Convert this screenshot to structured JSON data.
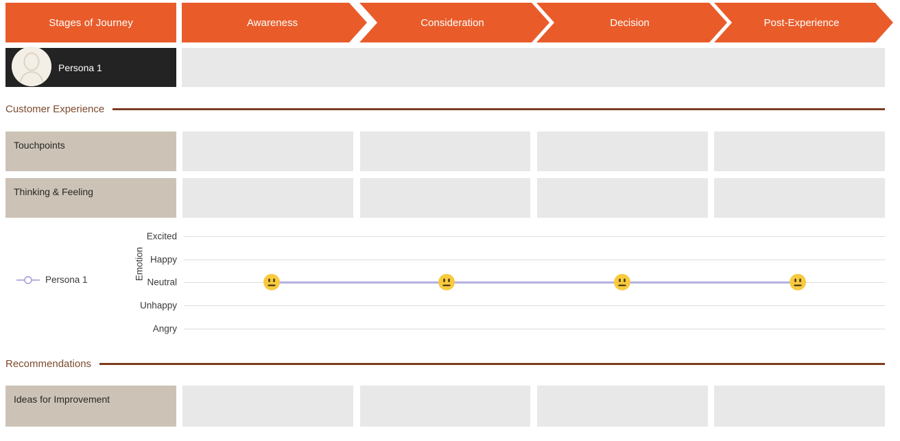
{
  "header": {
    "stage_title": "Stages of Journey",
    "stages": [
      {
        "label": "Awareness"
      },
      {
        "label": "Consideration"
      },
      {
        "label": "Decision"
      },
      {
        "label": "Post-Experience"
      }
    ]
  },
  "persona": {
    "name": "Persona 1",
    "avatar_icon": "person-silhouette-icon",
    "cell_value": ""
  },
  "sections": {
    "customer_experience": "Customer Experience",
    "recommendations": "Recommendations"
  },
  "rows": [
    {
      "label": "Touchpoints",
      "cells": [
        "",
        "",
        "",
        ""
      ]
    },
    {
      "label": "Thinking & Feeling",
      "cells": [
        "",
        "",
        "",
        ""
      ]
    },
    {
      "label": "Ideas for Improvement",
      "cells": [
        "",
        "",
        "",
        ""
      ]
    }
  ],
  "colors": {
    "stage_orange": "#e95c2a",
    "persona_dark": "#232323",
    "row_label_tan": "#ccc3b6",
    "cell_grey": "#e8e8e8",
    "section_brown": "#7c3b1e",
    "series_purple": "#b3b0e0",
    "emoji_yellow": "#f7ca3f",
    "gridline_grey": "#dcdcdc"
  },
  "chart_data": {
    "type": "line",
    "title": "",
    "xlabel": "",
    "ylabel": "Emotion",
    "categories": [
      "Awareness",
      "Consideration",
      "Decision",
      "Post-Experience"
    ],
    "y_categories": [
      "Excited",
      "Happy",
      "Neutral",
      "Unhappy",
      "Angry"
    ],
    "grid": true,
    "legend_position": "left",
    "series": [
      {
        "name": "Persona 1",
        "color": "#b3b0e0",
        "marker": "neutral-face-emoji",
        "values": [
          "Neutral",
          "Neutral",
          "Neutral",
          "Neutral"
        ],
        "numeric_values": [
          3,
          3,
          3,
          3
        ]
      }
    ]
  }
}
